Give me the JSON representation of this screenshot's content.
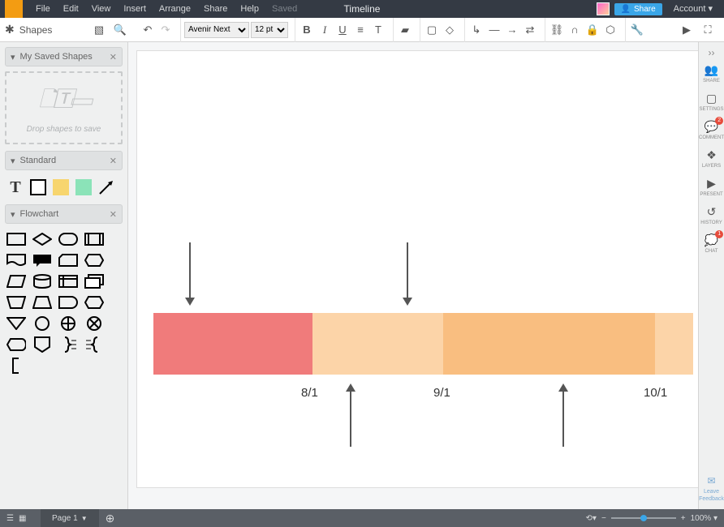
{
  "menubar": {
    "items": [
      "File",
      "Edit",
      "View",
      "Insert",
      "Arrange",
      "Share",
      "Help"
    ],
    "saved": "Saved",
    "title": "Timeline",
    "share": "Share",
    "account": "Account ▾"
  },
  "toolbar": {
    "shapes_label": "Shapes",
    "font": "Avenir Next",
    "size": "12 pt"
  },
  "sidebar": {
    "saved_shapes": {
      "title": "My Saved Shapes",
      "dropzone": "Drop shapes to save"
    },
    "standard": {
      "title": "Standard"
    },
    "flowchart": {
      "title": "Flowchart"
    }
  },
  "rightrail": {
    "share": "SHARE",
    "settings": "SETTINGS",
    "comment": "COMMENT",
    "comment_badge": "2",
    "layers": "LAYERS",
    "present": "PRESENT",
    "history": "HISTORY",
    "chat": "CHAT",
    "chat_badge": "1",
    "feedback": "Leave Feedback"
  },
  "bottombar": {
    "page_label": "Page 1",
    "zoom": "100% ▾"
  },
  "timeline": {
    "labels": [
      "8/1",
      "9/1",
      "10/1"
    ]
  }
}
